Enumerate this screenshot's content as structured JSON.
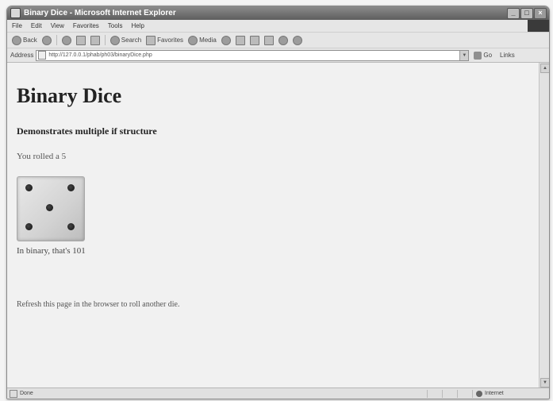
{
  "window": {
    "title": "Binary Dice - Microsoft Internet Explorer",
    "minimize": "_",
    "maximize": "□",
    "close": "×"
  },
  "menubar": {
    "items": [
      "File",
      "Edit",
      "View",
      "Favorites",
      "Tools",
      "Help"
    ]
  },
  "toolbar": {
    "back": "Back",
    "search": "Search",
    "favorites": "Favorites",
    "media": "Media"
  },
  "addressbar": {
    "label": "Address",
    "url": "http://127.0.0.1/phab/ph03/binaryDice.php",
    "go": "Go",
    "links": "Links"
  },
  "page": {
    "title": "Binary Dice",
    "subtitle": "Demonstrates multiple if structure",
    "rolled": "You rolled a 5",
    "binary": "In binary, that's 101",
    "refresh": "Refresh this page in the browser to roll another die."
  },
  "die": {
    "value": 5
  },
  "statusbar": {
    "text": "Done",
    "zone": "Internet"
  }
}
